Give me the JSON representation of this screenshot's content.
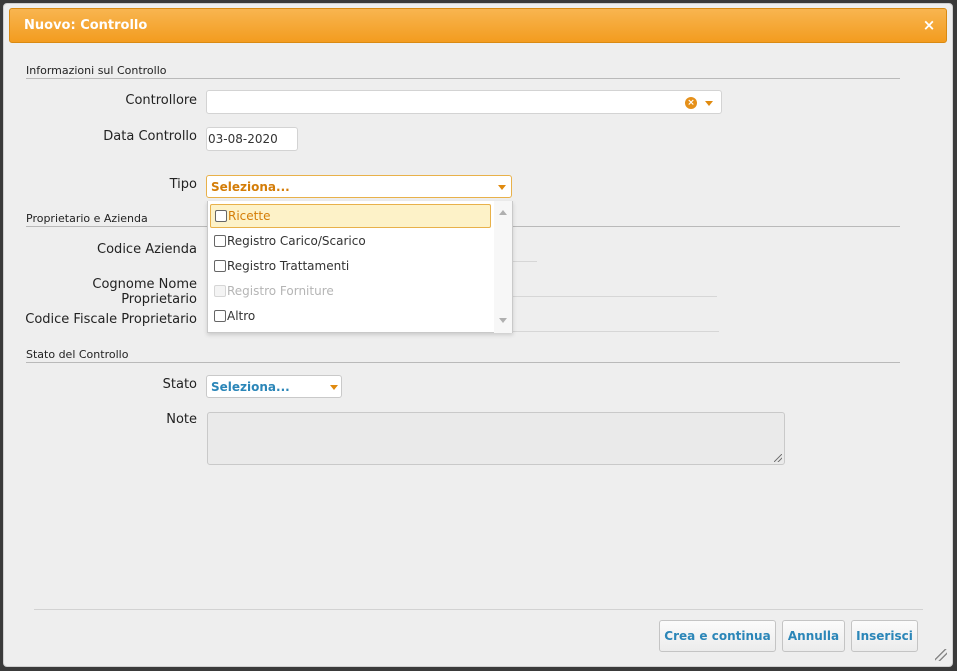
{
  "dialog": {
    "title": "Nuovo: Controllo",
    "close_label": "×"
  },
  "sections": {
    "info": "Informazioni sul Controllo",
    "owner": "Proprietario e Azienda",
    "status": "Stato del Controllo"
  },
  "fields": {
    "controllore": {
      "label": "Controllore",
      "value": ""
    },
    "data_controllo": {
      "label": "Data Controllo",
      "value": "03-08-2020"
    },
    "tipo": {
      "label": "Tipo",
      "value": "Seleziona...",
      "options": [
        {
          "label": "Ricette",
          "state": "highlighted"
        },
        {
          "label": "Registro Carico/Scarico",
          "state": "normal"
        },
        {
          "label": "Registro Trattamenti",
          "state": "normal"
        },
        {
          "label": "Registro Forniture",
          "state": "disabled"
        },
        {
          "label": "Altro",
          "state": "normal"
        }
      ]
    },
    "codice_azienda": {
      "label": "Codice Azienda"
    },
    "cognome_nome": {
      "label": "Cognome Nome Proprietario"
    },
    "codice_fiscale": {
      "label": "Codice Fiscale Proprietario"
    },
    "stato": {
      "label": "Stato",
      "value": "Seleziona..."
    },
    "note": {
      "label": "Note",
      "value": ""
    }
  },
  "buttons": {
    "crea_continua": "Crea e continua",
    "annulla": "Annulla",
    "inserisci": "Inserisci"
  },
  "colors": {
    "title_bar": "#f39c1f",
    "accent_orange": "#e08a0f",
    "link_blue": "#2b86b8",
    "highlight_bg": "#fdf2c8"
  },
  "icons": {
    "close": "close-icon",
    "clear": "clear-icon",
    "dropdown": "chevron-down-icon",
    "resize": "resize-grip-icon"
  }
}
